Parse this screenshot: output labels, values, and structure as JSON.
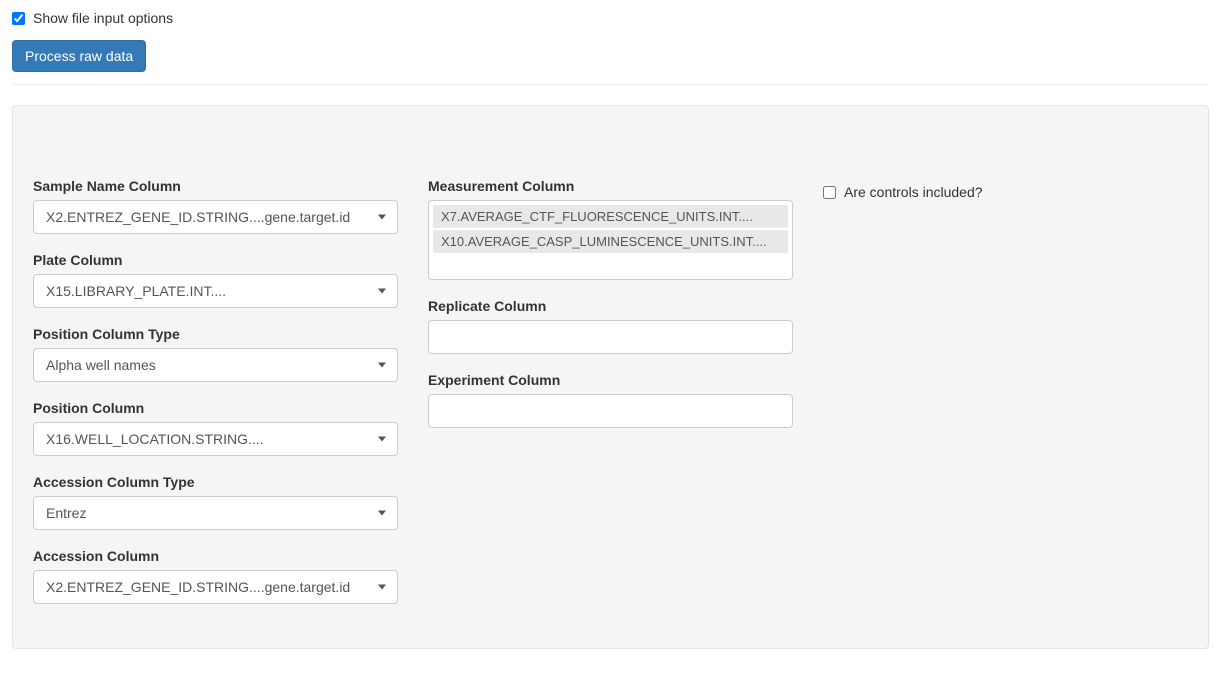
{
  "top": {
    "show_file_input_label": "Show file input options",
    "show_file_input_checked": true,
    "process_button_label": "Process raw data"
  },
  "col1": {
    "sample_name_label": "Sample Name Column",
    "sample_name_value": "X2.ENTREZ_GENE_ID.STRING....gene.target.id",
    "plate_label": "Plate Column",
    "plate_value": "X15.LIBRARY_PLATE.INT....",
    "position_type_label": "Position Column Type",
    "position_type_value": "Alpha well names",
    "position_label": "Position Column",
    "position_value": "X16.WELL_LOCATION.STRING....",
    "accession_type_label": "Accession Column Type",
    "accession_type_value": "Entrez",
    "accession_label": "Accession Column",
    "accession_value": "X2.ENTREZ_GENE_ID.STRING....gene.target.id"
  },
  "col2": {
    "measurement_label": "Measurement Column",
    "measurement_items": [
      "X7.AVERAGE_CTF_FLUORESCENCE_UNITS.INT....",
      "X10.AVERAGE_CASP_LUMINESCENCE_UNITS.INT...."
    ],
    "replicate_label": "Replicate Column",
    "replicate_value": "",
    "experiment_label": "Experiment Column",
    "experiment_value": ""
  },
  "col3": {
    "controls_label": "Are controls included?",
    "controls_checked": false
  }
}
